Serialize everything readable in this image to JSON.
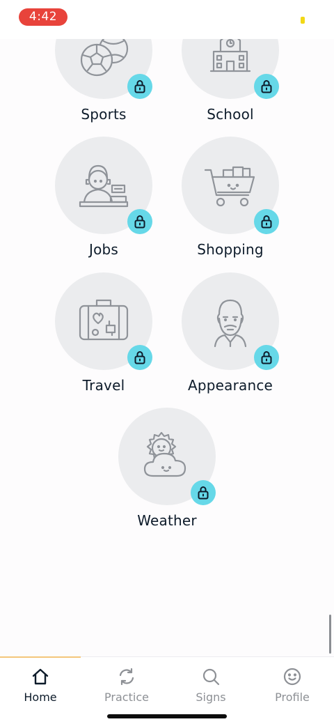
{
  "status_bar": {
    "time": "4:42"
  },
  "categories": [
    {
      "label": "Sports",
      "icon": "sports-balls-icon",
      "locked": true
    },
    {
      "label": "School",
      "icon": "school-building-icon",
      "locked": true
    },
    {
      "label": "Jobs",
      "icon": "cashier-worker-icon",
      "locked": true
    },
    {
      "label": "Shopping",
      "icon": "shopping-cart-icon",
      "locked": true
    },
    {
      "label": "Travel",
      "icon": "suitcase-icon",
      "locked": true
    },
    {
      "label": "Appearance",
      "icon": "bearded-man-icon",
      "locked": true
    },
    {
      "label": "Weather",
      "icon": "sun-cloud-icon",
      "locked": true
    }
  ],
  "bottom_nav": {
    "items": [
      {
        "label": "Home",
        "icon": "home-icon",
        "active": true
      },
      {
        "label": "Practice",
        "icon": "refresh-icon",
        "active": false
      },
      {
        "label": "Signs",
        "icon": "search-icon",
        "active": false
      },
      {
        "label": "Profile",
        "icon": "smiley-icon",
        "active": false
      }
    ]
  },
  "colors": {
    "status_pill": "#e8433b",
    "lock_badge": "#66d8e8",
    "circle_bg": "#ebecee",
    "text_dark": "#0d1b2a",
    "nav_inactive": "#8d9095",
    "nav_active_accent": "#f4c67a"
  }
}
